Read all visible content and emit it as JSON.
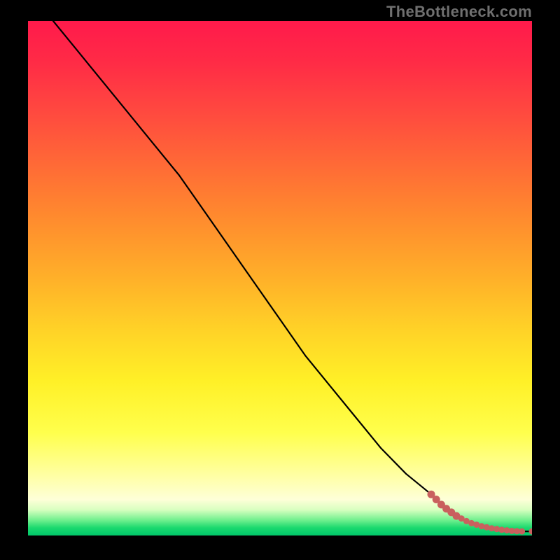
{
  "attribution": "TheBottleneck.com",
  "chart_data": {
    "type": "line",
    "title": "",
    "xlabel": "",
    "ylabel": "",
    "xlim": [
      0,
      100
    ],
    "ylim": [
      0,
      100
    ],
    "grid": false,
    "series": [
      {
        "name": "curve",
        "x": [
          5,
          10,
          15,
          20,
          25,
          30,
          35,
          40,
          45,
          50,
          55,
          60,
          65,
          70,
          75,
          80,
          82,
          84,
          86,
          88,
          90,
          92,
          94,
          96,
          98,
          100
        ],
        "y": [
          100,
          94,
          88,
          82,
          76,
          70,
          63,
          56,
          49,
          42,
          35,
          29,
          23,
          17,
          12,
          8,
          6,
          4.5,
          3.3,
          2.4,
          1.8,
          1.4,
          1.1,
          0.9,
          0.8,
          0.8
        ]
      }
    ],
    "scatter": {
      "name": "tail-points",
      "x": [
        80,
        81,
        82,
        83,
        84,
        85,
        86,
        87,
        88,
        89,
        90,
        91,
        92,
        93,
        94,
        95,
        96,
        97,
        98,
        100
      ],
      "y": [
        8.0,
        7.0,
        6.0,
        5.2,
        4.5,
        3.8,
        3.3,
        2.8,
        2.4,
        2.1,
        1.8,
        1.6,
        1.4,
        1.25,
        1.1,
        1.0,
        0.9,
        0.85,
        0.8,
        0.8
      ],
      "color": "#c9605e"
    },
    "background_gradient": {
      "stops": [
        {
          "pos": 0.0,
          "color": "#ff1a4b"
        },
        {
          "pos": 0.5,
          "color": "#ffb029"
        },
        {
          "pos": 0.8,
          "color": "#ffff4c"
        },
        {
          "pos": 0.95,
          "color": "#d8ffc0"
        },
        {
          "pos": 1.0,
          "color": "#00c76a"
        }
      ]
    }
  }
}
